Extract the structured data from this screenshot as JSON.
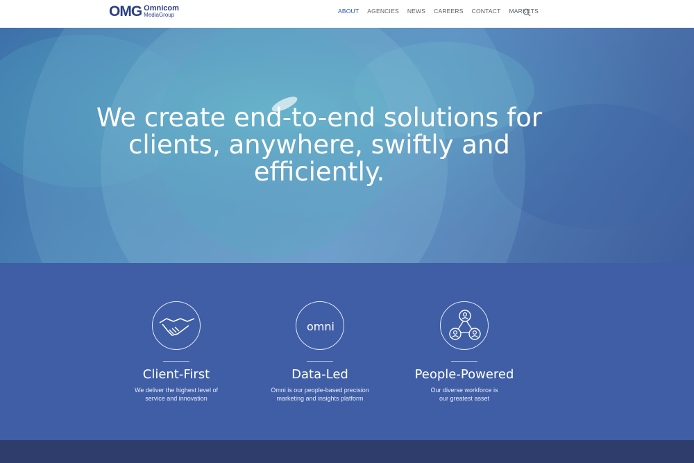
{
  "header": {
    "logo_mark": "OMG",
    "logo_line1": "Omnicom",
    "logo_line2": "MediaGroup",
    "nav": [
      "ABOUT",
      "AGENCIES",
      "NEWS",
      "CAREERS",
      "CONTACT",
      "MARKETS"
    ],
    "active_nav": "ABOUT",
    "search_icon": "search-icon"
  },
  "hero": {
    "title": "We create end-to-end solutions for clients, anywhere, swiftly and efficiently."
  },
  "pillars": [
    {
      "icon": "handshake-icon",
      "title": "Client-First",
      "desc_line1": "We deliver the highest level of",
      "desc_line2": "service and innovation"
    },
    {
      "icon": "omni-logo-icon",
      "icon_text": "omni",
      "title": "Data-Led",
      "desc_line1": "Omni is our people-based precision",
      "desc_line2": "marketing and insights platform"
    },
    {
      "icon": "people-network-icon",
      "title": "People-Powered",
      "desc_line1": "Our diverse workforce is",
      "desc_line2": "our greatest asset"
    }
  ],
  "colors": {
    "brand": "#2a3f86",
    "nav_active": "#2a52a8",
    "pillars_bg": "#3f5ea6",
    "footer_bg": "#2e3d6b"
  }
}
